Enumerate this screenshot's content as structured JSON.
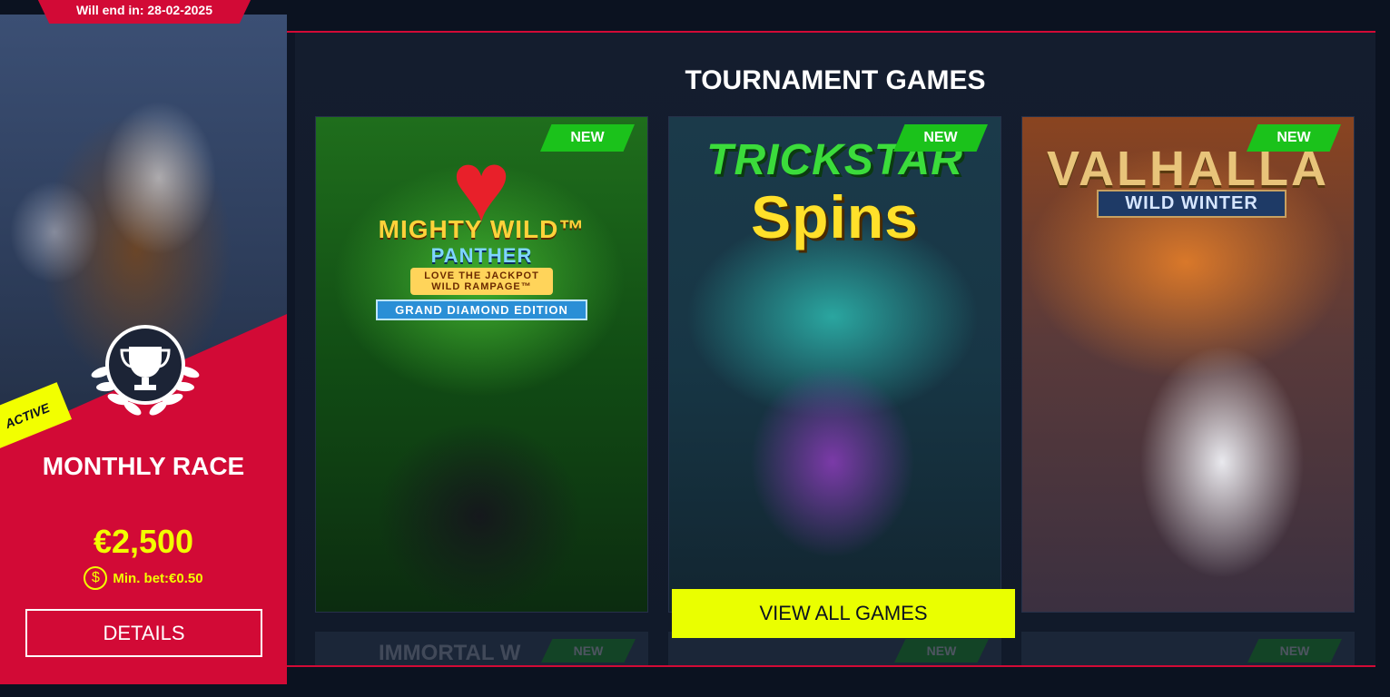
{
  "promo": {
    "end_label": "Will end in: 28-02-2025",
    "status_badge": "ACTIVE",
    "title": "MONTHLY RACE",
    "prize": "€2,500",
    "min_bet": "Min. bet:€0.50",
    "coin_symbol": "$",
    "details_label": "DETAILS",
    "accent_color": "#d20a36",
    "highlight_color": "#f2ff00",
    "trophy_icon": "trophy-icon"
  },
  "tournament": {
    "title": "TOURNAMENT GAMES",
    "view_all_label": "VIEW ALL GAMES",
    "games": [
      {
        "logo_line1": "MIGHTY WILD™",
        "logo_line2": "PANTHER",
        "logo_line3": "LOVE THE JACKPOT WILD RAMPAGE™",
        "logo_line4": "GRAND DIAMOND EDITION",
        "badge": "NEW"
      },
      {
        "logo_line1": "TRICKSTAR",
        "logo_line2": "Spins",
        "badge": "NEW"
      },
      {
        "logo_line1": "VALHALLA",
        "logo_line2": "WILD WINTER",
        "badge": "NEW"
      }
    ],
    "next_row": [
      {
        "text": "IMMORTAL W",
        "badge": "NEW"
      },
      {
        "text": "",
        "badge": "NEW"
      },
      {
        "text": "",
        "badge": "NEW"
      }
    ],
    "badge_color": "#1bc21b",
    "button_color": "#eaff00"
  }
}
